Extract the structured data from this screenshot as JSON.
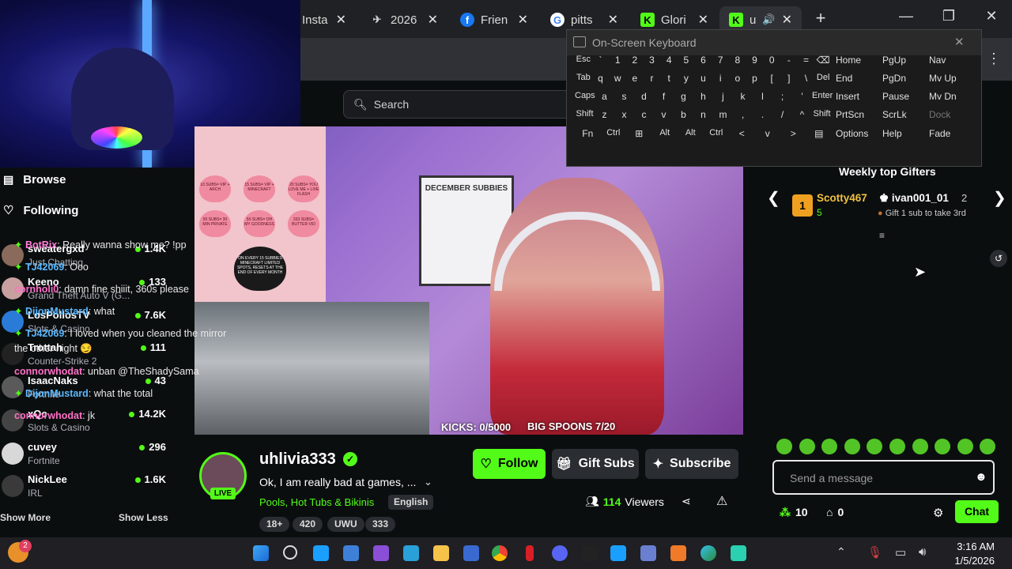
{
  "tabs": [
    {
      "label": "Insta",
      "icon": "instagram-icon"
    },
    {
      "label": "2026",
      "icon": "plane-icon"
    },
    {
      "label": "Frien",
      "icon": "facebook-icon"
    },
    {
      "label": "pitts",
      "icon": "google-icon"
    },
    {
      "label": "Glori",
      "icon": "kick-icon"
    },
    {
      "label": "u",
      "icon": "kick-icon"
    }
  ],
  "search": {
    "placeholder": "Search"
  },
  "osk": {
    "title": "On-Screen Keyboard",
    "rows": [
      [
        "Esc",
        "`",
        "1",
        "2",
        "3",
        "4",
        "5",
        "6",
        "7",
        "8",
        "9",
        "0",
        "-",
        "=",
        "⌫"
      ],
      [
        "Tab",
        "q",
        "w",
        "e",
        "r",
        "t",
        "y",
        "u",
        "i",
        "o",
        "p",
        "[",
        "]",
        "\\",
        "Del"
      ],
      [
        "Caps",
        "a",
        "s",
        "d",
        "f",
        "g",
        "h",
        "j",
        "k",
        "l",
        ";",
        "'",
        "Enter"
      ],
      [
        "Shift",
        "z",
        "x",
        "c",
        "v",
        "b",
        "n",
        "m",
        ",",
        ".",
        "/",
        "^",
        "Shift"
      ],
      [
        "Fn",
        "Ctrl",
        "⊞",
        "Alt",
        "Alt",
        "Ctrl",
        "<",
        "v",
        ">",
        "▤"
      ]
    ],
    "nav": [
      [
        "Home",
        "PgUp",
        "Nav"
      ],
      [
        "End",
        "PgDn",
        "Mv Up"
      ],
      [
        "Insert",
        "Pause",
        "Mv Dn"
      ],
      [
        "PrtScn",
        "ScrLk",
        "Dock"
      ],
      [
        "Options",
        "Help",
        "Fade"
      ]
    ]
  },
  "sidebar": {
    "browse": "Browse",
    "following": "Following",
    "channels": [
      {
        "name": "sweatergxd",
        "category": "Just Chatting",
        "viewers": "1.4K"
      },
      {
        "name": "Keeno",
        "category": "Grand Theft Auto V (G...",
        "viewers": "133"
      },
      {
        "name": "LosPollosTV",
        "category": "Slots & Casino",
        "viewers": "7.6K"
      },
      {
        "name": "Trottah",
        "category": "Counter-Strike 2",
        "viewers": "111"
      },
      {
        "name": "IsaacNaks",
        "category": "Fortnite",
        "viewers": "43"
      },
      {
        "name": "xQc",
        "category": "Slots & Casino",
        "viewers": "14.2K"
      },
      {
        "name": "cuvey",
        "category": "Fortnite",
        "viewers": "296"
      },
      {
        "name": "NickLee",
        "category": "IRL",
        "viewers": "1.6K"
      }
    ],
    "show_more": "Show More",
    "show_less": "Show Less"
  },
  "video": {
    "kicks": "KICKS: 0/5000",
    "spoons": "BIG SPOONS 7/20",
    "calendar_title": "DECEMBER SUBBIES",
    "board_hearts": [
      "10 SUBS= VIP + ARCH",
      "15 SUBS= VIP + MINECRAFT",
      "20 SUBS= YOU LOVE ME + LIVE FLASH",
      "50 SUBS= 30 MIN PRIVATE",
      "50 SUBS= OH MY GOODNESS",
      "333 SUBS= BUTTER VID"
    ],
    "board_note": "ON EVERY 15 SUBBIES MINECRAFT LIMITED SPOTS, RESETS AT THE END OF EVERY MONTH"
  },
  "stream": {
    "channel": "uhlivia333",
    "live": "LIVE",
    "title": "Ok, I am really bad at games, ...",
    "category": "Pools, Hot Tubs & Bikinis",
    "language": "English",
    "tags": [
      "18+",
      "420",
      "UWU",
      "333"
    ],
    "viewers": "114",
    "viewers_label": "Viewers",
    "follow": "Follow",
    "gift_subs": "Gift Subs",
    "subscribe": "Subscribe"
  },
  "chat": {
    "gifters_title": "Weekly top Gifters",
    "gifter1": {
      "name": "Scotty467",
      "rank": "1",
      "count": "5"
    },
    "gifter2": {
      "name": "ivan001_01",
      "count": "2",
      "cta": "Gift 1 sub to take 3rd"
    },
    "messages": [
      {
        "user": "BotRix",
        "text": ": Really wanna show me? !pp",
        "color": "#ff7fd6"
      },
      {
        "user": "TJ42069",
        "text": ": Ooo",
        "color": "#5ab8ff"
      },
      {
        "user": "cornholi0",
        "text": ": damn fine shiiit, 360s please",
        "color": "#ff70c8"
      },
      {
        "user": "DijonMustard",
        "text": ": what",
        "color": "#5ab8ff"
      },
      {
        "user": "TJ42069",
        "text": ": I loved when you cleaned the mirror the other night 😏",
        "color": "#5ab8ff"
      },
      {
        "user": "connorwhodat",
        "text": ": unban @TheShadySama",
        "color": "#ff70c8"
      },
      {
        "user": "DijonMustard",
        "text": ": what the total",
        "color": "#5ab8ff"
      },
      {
        "user": "connorwhodat",
        "text": ": jk",
        "color": "#ff70c8"
      }
    ],
    "placeholder": "Send a message",
    "points": "10",
    "gifts": "0",
    "chat_button": "Chat"
  },
  "taskbar": {
    "time": "3:16 AM",
    "date": "1/5/2026",
    "weather_badge": "2"
  },
  "colors": {
    "accent": "#53fc18",
    "bg": "#0b0e0f"
  }
}
